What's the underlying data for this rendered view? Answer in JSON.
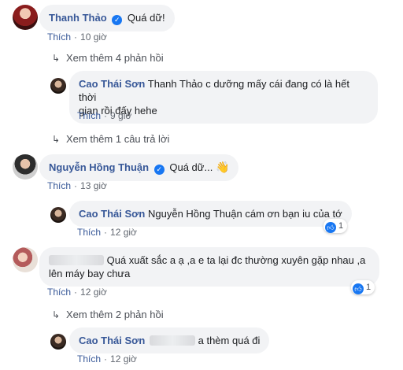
{
  "comments": [
    {
      "author": "Thanh Thảo",
      "text": "Quá dữ!",
      "like_label": "Thích",
      "time": "10 giờ",
      "more_replies": "Xem thêm 4 phản hồi",
      "reply": {
        "author": "Cao Thái Sơn",
        "text_line1": "Thanh Thảo c dưỡng mấy cái đang có là hết thời",
        "text_line2": "gian rồi đấy hehe",
        "like_label": "Thích",
        "time": "9 giờ"
      },
      "more_replies_2": "Xem thêm 1 câu trả lời"
    },
    {
      "author": "Nguyễn Hồng Thuận",
      "text": "Quá dữ...",
      "like_label": "Thích",
      "time": "13 giờ",
      "reply": {
        "author": "Cao Thái Sơn",
        "text": "Nguyễn Hồng Thuận cám ơn bạn iu của tớ",
        "like_label": "Thích",
        "time": "12 giờ",
        "reactions": "1"
      }
    },
    {
      "text_line1": "Quá xuất sắc a ạ ,a e ta lại đc thường xuyên gặp nhau ,a",
      "text_line2": "lên máy bay chưa",
      "like_label": "Thích",
      "time": "12 giờ",
      "reactions": "1",
      "more_replies": "Xem thêm 2 phản hồi",
      "reply": {
        "author": "Cao Thái Sơn",
        "text": "a thèm quá đi",
        "like_label": "Thích",
        "time": "12 giờ"
      }
    }
  ],
  "icons": {
    "verified": "✓",
    "reply_arrow": "↳",
    "like_thumb": "👍",
    "wave_emoji": "👋"
  },
  "colors": {
    "name": "#385898",
    "bubble": "#f2f3f5",
    "meta": "#616770",
    "like_blue": "#1877f2"
  }
}
